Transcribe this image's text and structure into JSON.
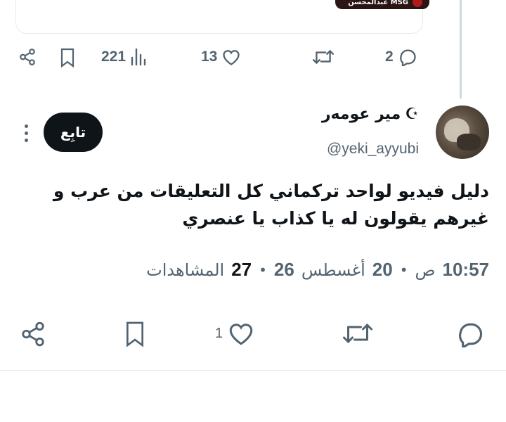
{
  "quoted_card": {
    "thumbnail_label": "عبدالمحسن MSG"
  },
  "top_actions": {
    "views_count": "221",
    "likes_count": "13",
    "replies_count": "2"
  },
  "tweet": {
    "author_name": "مير عومەر",
    "author_emoji": "☪",
    "handle": "@yeki_ayyubi",
    "follow_label": "تابِع",
    "text": "دليل فيديو لواحد تركماني كل التعليقات من عرب و غيرهم يقولون له يا كذاب يا عنصري",
    "time": "10:57",
    "ampm": "ص",
    "date_day": "20",
    "date_month": "أغسطس",
    "date_year": "26",
    "views": "27",
    "views_label": "المشاهدات",
    "separator": "•"
  },
  "bottom_actions": {
    "likes_count": "1"
  },
  "colors": {
    "text": "#0f1419",
    "muted": "#536471",
    "divider": "#e6e9ec",
    "thread_line": "#cfd9de"
  }
}
